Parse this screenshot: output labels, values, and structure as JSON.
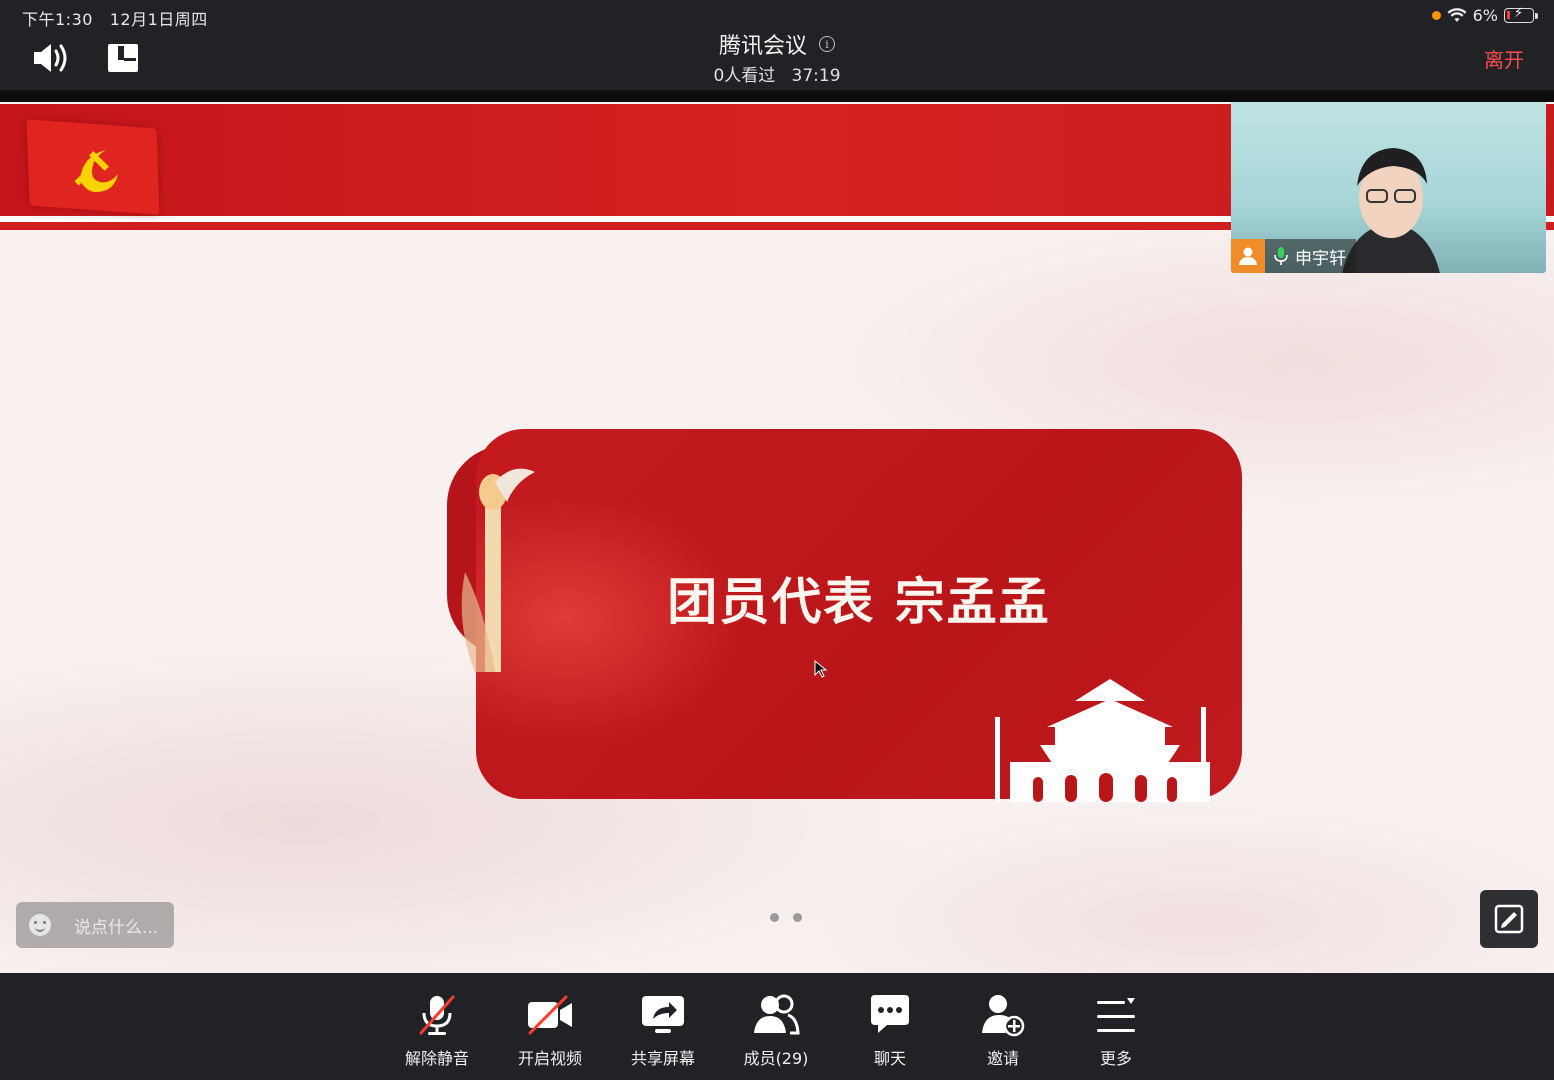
{
  "status_bar": {
    "time": "下午1:30",
    "date": "12月1日周四",
    "battery": "6%"
  },
  "header": {
    "title": "腾讯会议",
    "viewers": "0人看过",
    "duration": "37:19",
    "leave_label": "离开"
  },
  "slide": {
    "title": "团员代表 宗孟孟",
    "page_count": 2
  },
  "video_tile": {
    "name": "申宇轩"
  },
  "chat": {
    "placeholder": "说点什么..."
  },
  "toolbar": {
    "unmute": "解除静音",
    "start_video": "开启视频",
    "share_screen": "共享屏幕",
    "members": "成员(29)",
    "chat": "聊天",
    "invite": "邀请",
    "more": "更多"
  },
  "colors": {
    "leave": "#ff4d4f",
    "slide_red": "#c4161c",
    "toolbar_bg": "#202226"
  }
}
